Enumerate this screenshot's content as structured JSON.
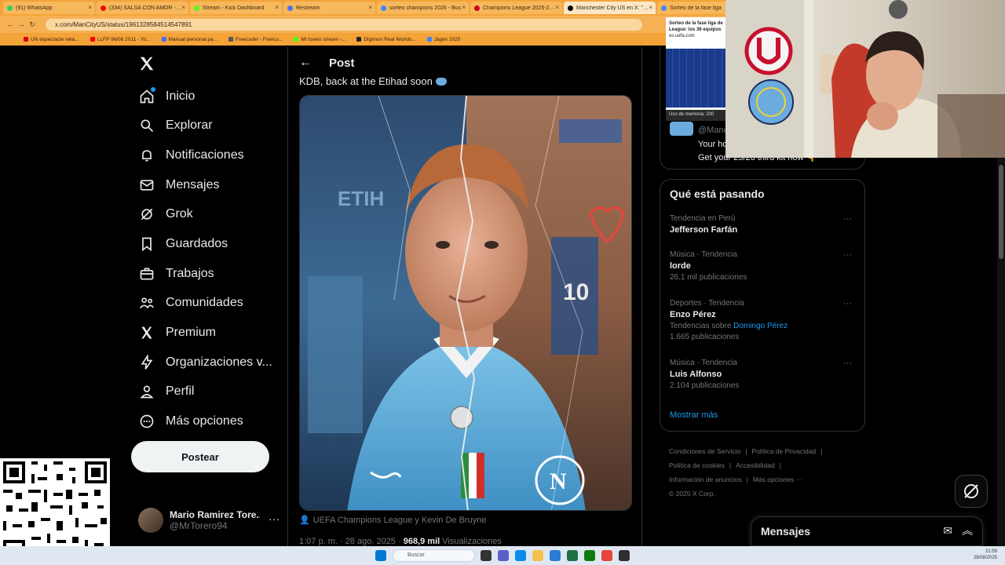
{
  "browser": {
    "tabs": [
      {
        "title": "(91) WhatsApp",
        "color": "#25d366"
      },
      {
        "title": "(334) SALSA CON AMOR - 40",
        "color": "#ff0000"
      },
      {
        "title": "Stream - Kick Dashboard",
        "color": "#53fc18"
      },
      {
        "title": "Restream",
        "color": "#4c6ef5"
      },
      {
        "title": "sorteo champions 2026 - Bus",
        "color": "#4285f4"
      },
      {
        "title": "Champions League 2025-2026",
        "color": "#d0021b"
      },
      {
        "title": "Manchester City US en X: \"KD",
        "color": "#000000"
      },
      {
        "title": "Sorteo de la fase liga",
        "color": "#4285f4"
      }
    ],
    "url": "x.com/ManCityUS/status/1961328584514547891",
    "bookmarks": [
      {
        "label": "UN espectacle nela...",
        "color": "#d0021b"
      },
      {
        "label": "LLFP 96/06 2011 - Yo...",
        "color": "#ff0000"
      },
      {
        "label": "Manual personal pa...",
        "color": "#4c6ef5"
      },
      {
        "label": "Freecodel - Freeco...",
        "color": "#555555"
      },
      {
        "label": "Mi tovelo stream -...",
        "color": "#53fc18"
      },
      {
        "label": "Digimon Real Worlds...",
        "color": "#222222"
      },
      {
        "label": "Jagex 2025",
        "color": "#4285f4"
      }
    ]
  },
  "nav": {
    "items": [
      {
        "label": "Inicio",
        "icon": "home-icon"
      },
      {
        "label": "Explorar",
        "icon": "search-icon"
      },
      {
        "label": "Notificaciones",
        "icon": "bell-icon"
      },
      {
        "label": "Mensajes",
        "icon": "envelope-icon"
      },
      {
        "label": "Grok",
        "icon": "grok-icon"
      },
      {
        "label": "Guardados",
        "icon": "bookmark-icon"
      },
      {
        "label": "Trabajos",
        "icon": "briefcase-icon"
      },
      {
        "label": "Comunidades",
        "icon": "people-icon"
      },
      {
        "label": "Premium",
        "icon": "x-icon"
      },
      {
        "label": "Organizaciones v...",
        "icon": "lightning-icon"
      },
      {
        "label": "Perfil",
        "icon": "person-icon"
      },
      {
        "label": "Más opciones",
        "icon": "more-circle-icon"
      }
    ],
    "post_button": "Postear",
    "profile": {
      "name": "Mario Ramirez Tore...",
      "handle": "@MrTorero94"
    }
  },
  "post": {
    "header_title": "Post",
    "text": "KDB, back at the Etihad soon",
    "image_caption_tags": "UEFA Champions League y Kevin De Bruyne",
    "time": "1:07 p. m. · 28 ago. 2025 · ",
    "views": "968,9 mil",
    "views_label": " Visualizaciones"
  },
  "promo": {
    "handle": "@Manc",
    "line1": "Your ho",
    "line2": "Get your 25/26 third kit now 👇"
  },
  "trends": {
    "title": "Qué está pasando",
    "items": [
      {
        "context": "Tendencia en Perú",
        "name": "Jefferson Farfán",
        "count": ""
      },
      {
        "context": "Música · Tendencia",
        "name": "lorde",
        "count": "26,1 mil publicaciones"
      },
      {
        "context": "Deportes · Tendencia",
        "name": "Enzo Pérez",
        "count_prefix": "Tendencias sobre ",
        "count_link": "Domingo Pérez",
        "count2": "1.665 publicaciones"
      },
      {
        "context": "Música · Tendencia",
        "name": "Luis Alfonso",
        "count": "2.104 publicaciones"
      }
    ],
    "show_more": "Mostrar más"
  },
  "footer": {
    "links": [
      "Condiciones de Servicio",
      "Política de Privacidad",
      "Política de cookies",
      "Accesibilidad",
      "Información de anuncios",
      "Más opciones ···"
    ],
    "copyright": "© 2025 X Corp."
  },
  "messages_dock": {
    "title": "Mensajes"
  },
  "mini_screen": {
    "text": "Sorteo de la fase liga de League: los 36 equipos",
    "source": "es.uefa.com",
    "bar": "Uso de memoria: 200"
  },
  "taskbar": {
    "search_placeholder": "Buscar",
    "time": "21:59",
    "date": "28/08/2025"
  }
}
